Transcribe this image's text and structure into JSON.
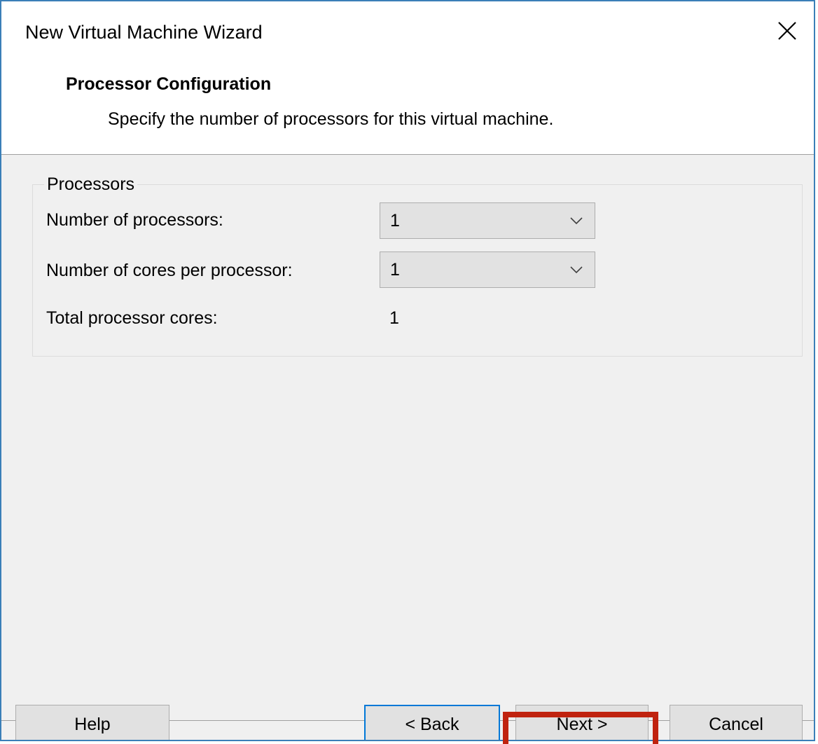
{
  "window": {
    "title": "New Virtual Machine Wizard",
    "close_icon": "close-icon"
  },
  "header": {
    "title": "Processor Configuration",
    "subtitle": "Specify the number of processors for this virtual machine."
  },
  "processors_group": {
    "legend": "Processors",
    "num_processors_label": "Number of processors:",
    "num_processors_value": "1",
    "cores_per_processor_label": "Number of cores per processor:",
    "cores_per_processor_value": "1",
    "total_cores_label": "Total processor cores:",
    "total_cores_value": "1"
  },
  "footer": {
    "help_label": "Help",
    "back_label": "< Back",
    "next_label": "Next >",
    "cancel_label": "Cancel"
  },
  "colors": {
    "window_border": "#3a7fb8",
    "default_button_border": "#0078d7",
    "highlight": "#c0230f",
    "background": "#f0f0f0"
  }
}
